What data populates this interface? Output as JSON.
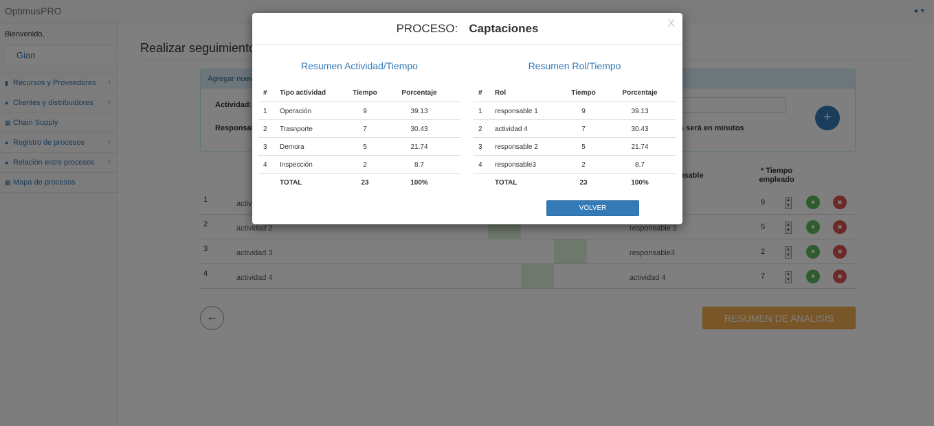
{
  "navbar": {
    "brand": "OptimusPRO",
    "user_icon": "user-icon"
  },
  "sidebar": {
    "welcome": "Bienvenido,",
    "user": "Gian",
    "items": [
      {
        "label": "Recursos y Proveedores",
        "icon": "truck-icon"
      },
      {
        "label": "Clientes y distribuidores",
        "icon": "users-icon"
      },
      {
        "label": "Chain Supply",
        "icon": "sitemap-icon"
      },
      {
        "label": "Registro de procesos",
        "icon": "users-icon"
      },
      {
        "label": "Relación entre procesos",
        "icon": "users-icon"
      },
      {
        "label": "Mapa de procesos",
        "icon": "sitemap-icon"
      }
    ]
  },
  "main": {
    "title": "Realizar seguimiento d",
    "panel_heading": "Agregar nueva",
    "actividad_label": "Actividad:",
    "responsable_label": "Responsab",
    "unit_note": "s será en minutos",
    "col_responsable": "onsable",
    "col_tiempo": "* Tiempo\nempleado",
    "rows": [
      {
        "num": "1",
        "actividad": "activ",
        "responsable": "",
        "tiempo": "9"
      },
      {
        "num": "2",
        "actividad": "actividad 2",
        "responsable": "responsable 2",
        "tiempo": "5"
      },
      {
        "num": "3",
        "actividad": "actividad 3",
        "responsable": "responsable3",
        "tiempo": "2"
      },
      {
        "num": "4",
        "actividad": "actividad 4",
        "responsable": "actividad 4",
        "tiempo": "7"
      }
    ],
    "resumen_button": "RESUMEN DE ANÁLISIS",
    "back_icon": "arrow-left-icon"
  },
  "modal": {
    "proceso_label": "PROCESO:",
    "proceso_name": "Captaciones",
    "close": "X",
    "actividad_table": {
      "title": "Resumen Actividad/Tiempo",
      "headers": [
        "#",
        "Tipo actividad",
        "Tiempo",
        "Porcentaje"
      ],
      "rows": [
        [
          "1",
          "Operación",
          "9",
          "39.13"
        ],
        [
          "2",
          "Trasnporte",
          "7",
          "30.43"
        ],
        [
          "3",
          "Demora",
          "5",
          "21.74"
        ],
        [
          "4",
          "Inspección",
          "2",
          "8.7"
        ]
      ],
      "total": [
        "",
        "TOTAL",
        "23",
        "100%"
      ]
    },
    "rol_table": {
      "title": "Resumen Rol/Tiempo",
      "headers": [
        "#",
        "Rol",
        "Tiempo",
        "Porcentaje"
      ],
      "rows": [
        [
          "1",
          "responsable 1",
          "9",
          "39.13"
        ],
        [
          "2",
          "actividad 4",
          "7",
          "30.43"
        ],
        [
          "3",
          "responsable 2",
          "5",
          "21.74"
        ],
        [
          "4",
          "responsable3",
          "2",
          "8.7"
        ]
      ],
      "total": [
        "",
        "TOTAL",
        "23",
        "100%"
      ]
    },
    "volver_button": "VOLVER"
  }
}
